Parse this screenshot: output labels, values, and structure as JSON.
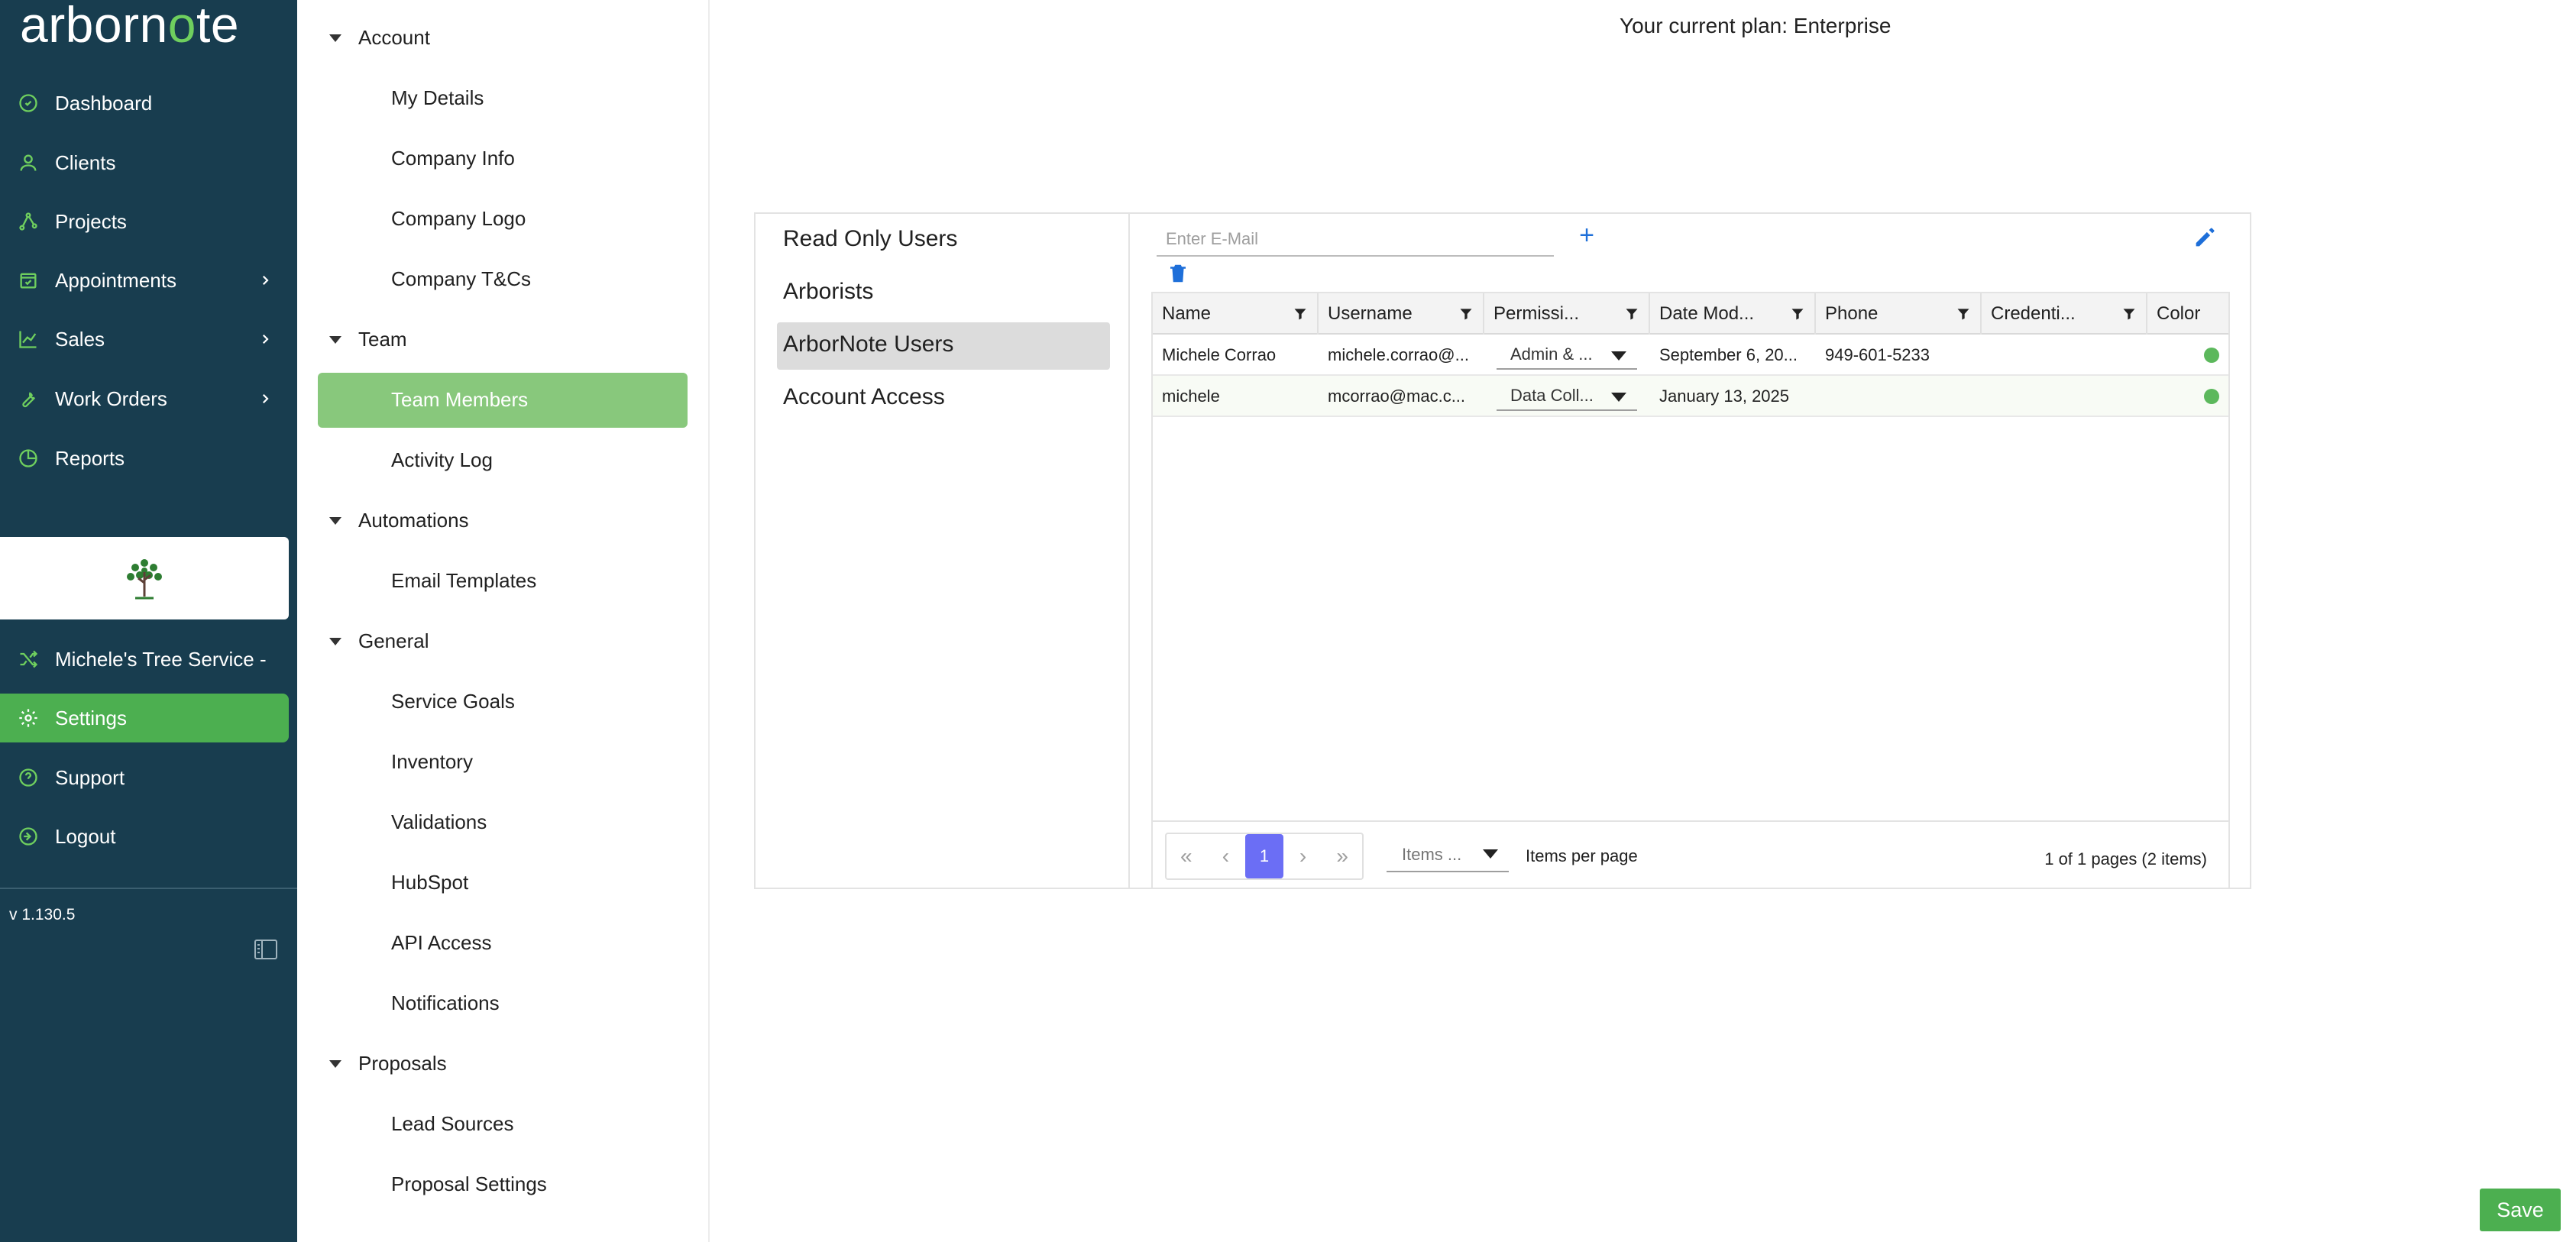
{
  "brand": {
    "logo_text_a": "arborn",
    "logo_text_o": "o",
    "logo_text_b": "te"
  },
  "sidebar": {
    "items": [
      {
        "label": "Dashboard",
        "icon": "dashboard-icon"
      },
      {
        "label": "Clients",
        "icon": "person-icon"
      },
      {
        "label": "Projects",
        "icon": "projects-icon"
      },
      {
        "label": "Appointments",
        "icon": "calendar-icon",
        "expandable": true
      },
      {
        "label": "Sales",
        "icon": "chart-line-icon",
        "expandable": true
      },
      {
        "label": "Work Orders",
        "icon": "wrench-icon",
        "expandable": true
      },
      {
        "label": "Reports",
        "icon": "pie-chart-icon"
      }
    ],
    "company": "Michele's Tree Service -",
    "bottom_items": [
      {
        "label": "Settings",
        "icon": "gear-icon",
        "active": true
      },
      {
        "label": "Support",
        "icon": "help-icon"
      },
      {
        "label": "Logout",
        "icon": "logout-icon"
      }
    ],
    "version": "v 1.130.5"
  },
  "settings_menu": {
    "groups": [
      {
        "label": "Account",
        "items": [
          "My Details",
          "Company Info",
          "Company Logo",
          "Company T&Cs"
        ]
      },
      {
        "label": "Team",
        "items": [
          "Team Members",
          "Activity Log"
        ]
      },
      {
        "label": "Automations",
        "items": [
          "Email Templates"
        ]
      },
      {
        "label": "General",
        "items": [
          "Service Goals",
          "Inventory",
          "Validations",
          "HubSpot",
          "API Access",
          "Notifications"
        ]
      },
      {
        "label": "Proposals",
        "items": [
          "Lead Sources",
          "Proposal Settings"
        ]
      }
    ],
    "active": "Team Members"
  },
  "main": {
    "plan_text": "Your current plan: Enterprise",
    "user_types": [
      "Read Only Users",
      "Arborists",
      "ArborNote Users",
      "Account Access"
    ],
    "active_user_type": "ArborNote Users",
    "email_placeholder": "Enter E-Mail",
    "columns": [
      "Name",
      "Username",
      "Permissi...",
      "Date Mod...",
      "Phone",
      "Credenti...",
      "Color"
    ],
    "rows": [
      {
        "name": "Michele Corrao",
        "username": "michele.corrao@...",
        "permission": "Admin & ...",
        "date": "September 6, 20...",
        "phone": "949-601-5233",
        "credentials": "",
        "color": "#5cb85c"
      },
      {
        "name": "michele",
        "username": "mcorrao@mac.c...",
        "permission": "Data Coll...",
        "date": "January 13, 2025",
        "phone": "",
        "credentials": "",
        "color": "#5cb85c"
      }
    ],
    "pager": {
      "current_page": "1",
      "items_select": "Items ...",
      "items_label": "Items per page",
      "info": "1 of 1 pages (2 items)"
    },
    "save_label": "Save"
  },
  "colors": {
    "sidebar_bg": "#183d4f",
    "accent_green": "#4caf50",
    "active_page": "#6b6ef5"
  }
}
